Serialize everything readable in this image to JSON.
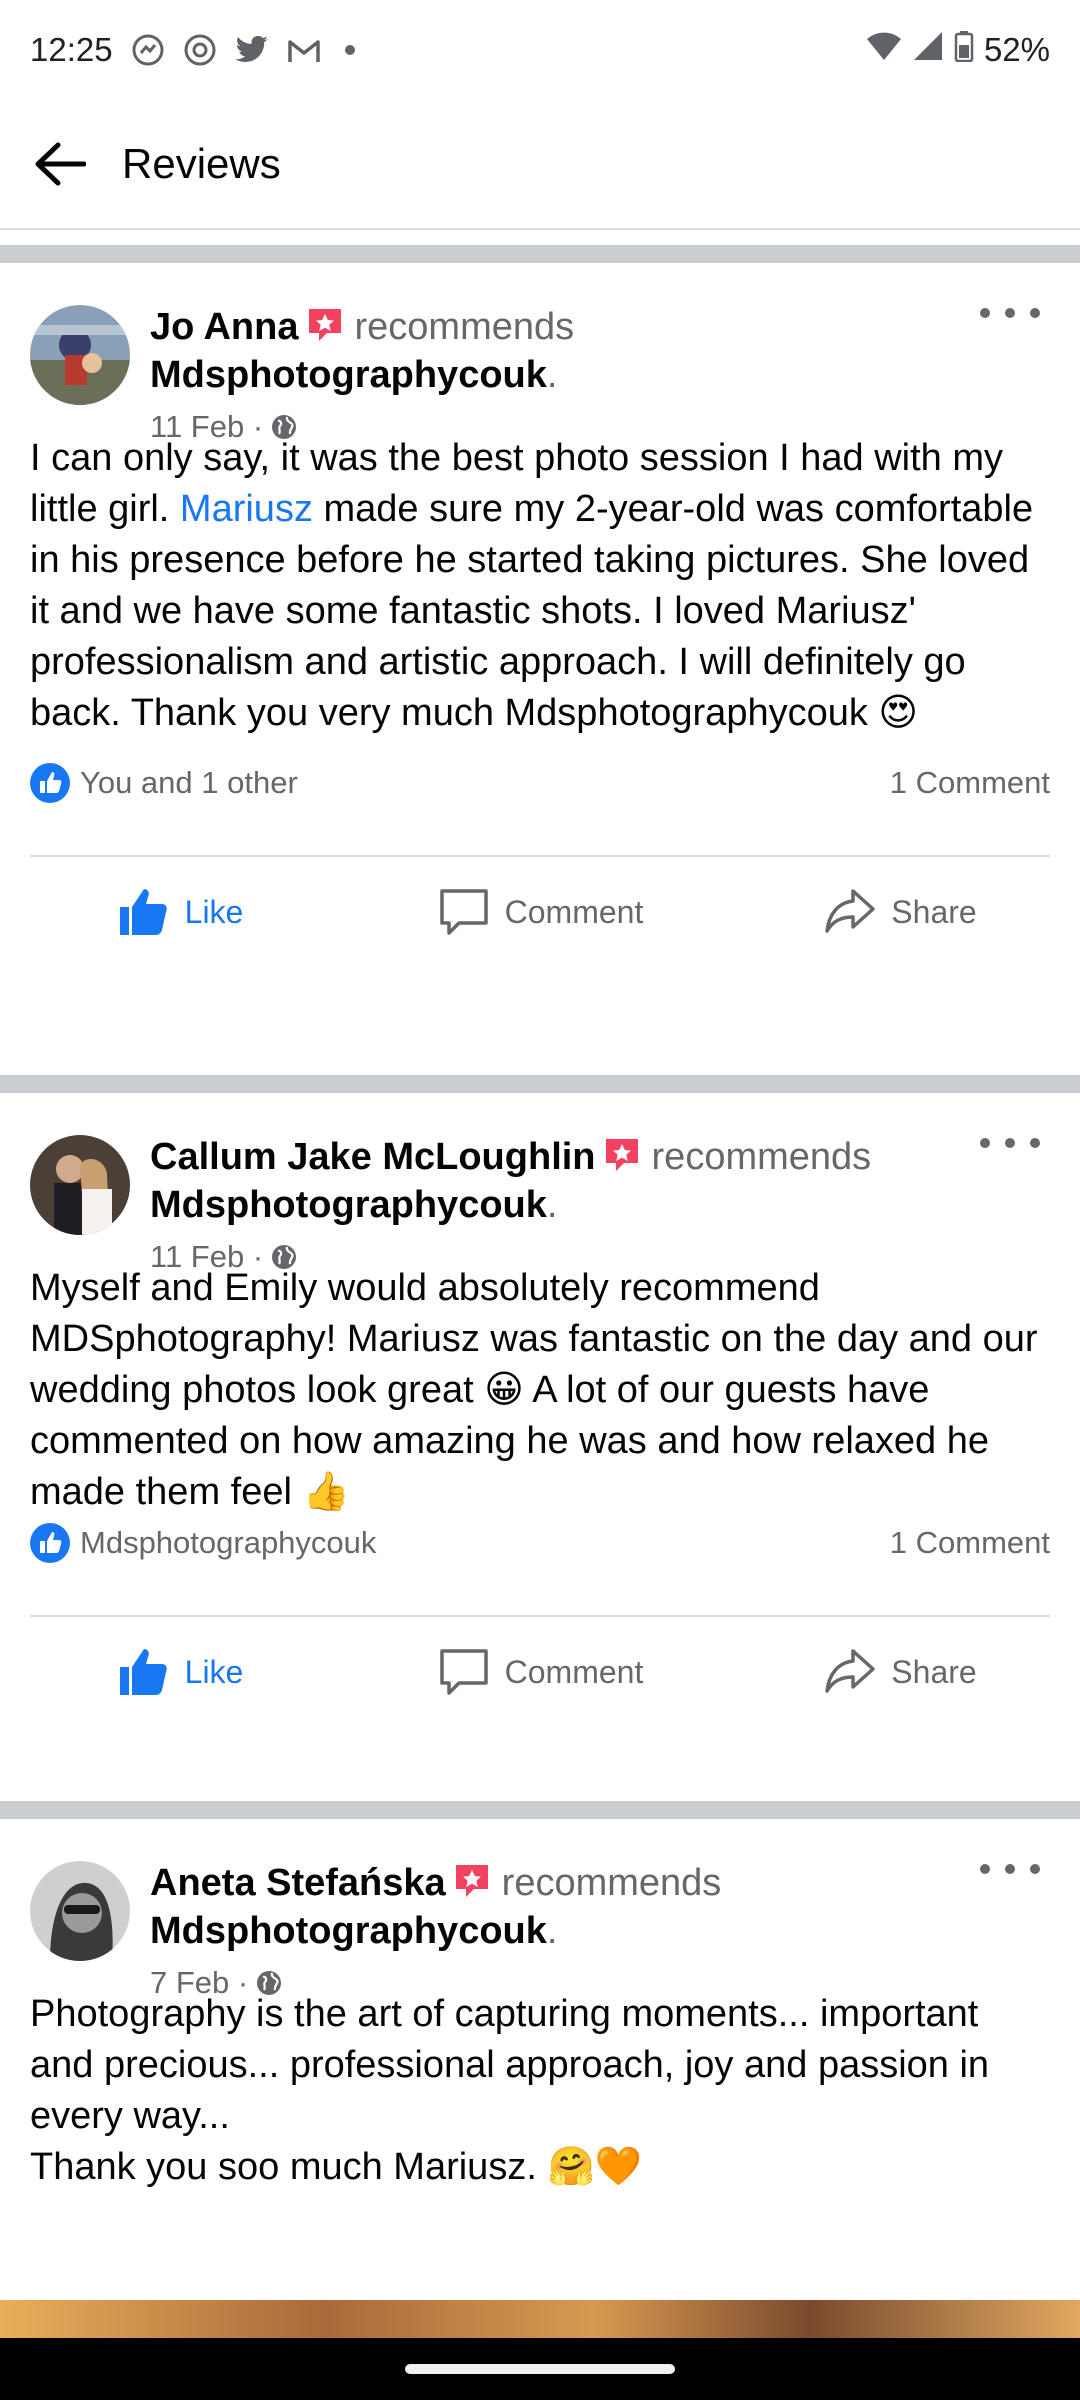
{
  "status": {
    "time": "12:25",
    "battery": "52%"
  },
  "header": {
    "title": "Reviews"
  },
  "reviews": [
    {
      "name": "Jo Anna",
      "recommends": "recommends",
      "page": "Mdsphotographycouk",
      "date": "11 Feb",
      "body_1": "I can only say, it was the best photo session I had with my little girl. ",
      "body_link": "Mariusz",
      "body_2": " made sure my 2-year-old was comfortable in his presence before he started taking pictures. She loved it and we have some fantastic shots. I loved Mariusz' professionalism and artistic approach.  I will definitely go back. Thank you very much Mdsphotographycouk ",
      "emoji": "😍",
      "reaction_text": "You and 1 other",
      "comments": "1 Comment"
    },
    {
      "name": "Callum Jake McLoughlin",
      "recommends": "recommends",
      "page": "Mdsphotographycouk",
      "date": "11 Feb",
      "body_1": "Myself and Emily would absolutely recommend MDSphotography! Mariusz was fantastic on the day and our wedding photos look great ",
      "emoji_1": "😀",
      "body_2": " A lot of our guests have commented on how amazing he was and how relaxed he made them feel ",
      "emoji_2": "👍",
      "reaction_text": "Mdsphotographycouk",
      "comments": "1 Comment"
    },
    {
      "name": "Aneta Stefańska",
      "recommends": "recommends",
      "page": "Mdsphotographycouk",
      "date": "7 Feb",
      "body_1": "Photography is the art of capturing moments... important and precious... professional approach, joy and passion in every way...",
      "body_2": "Thank you soo much Mariusz. ",
      "emoji": "🤗🧡"
    }
  ],
  "actions": {
    "like": "Like",
    "comment": "Comment",
    "share": "Share"
  },
  "colors": {
    "accent": "#1877f2",
    "divider": "#c9ccd1",
    "muted": "#65676b",
    "recommend": "#f3425f"
  }
}
